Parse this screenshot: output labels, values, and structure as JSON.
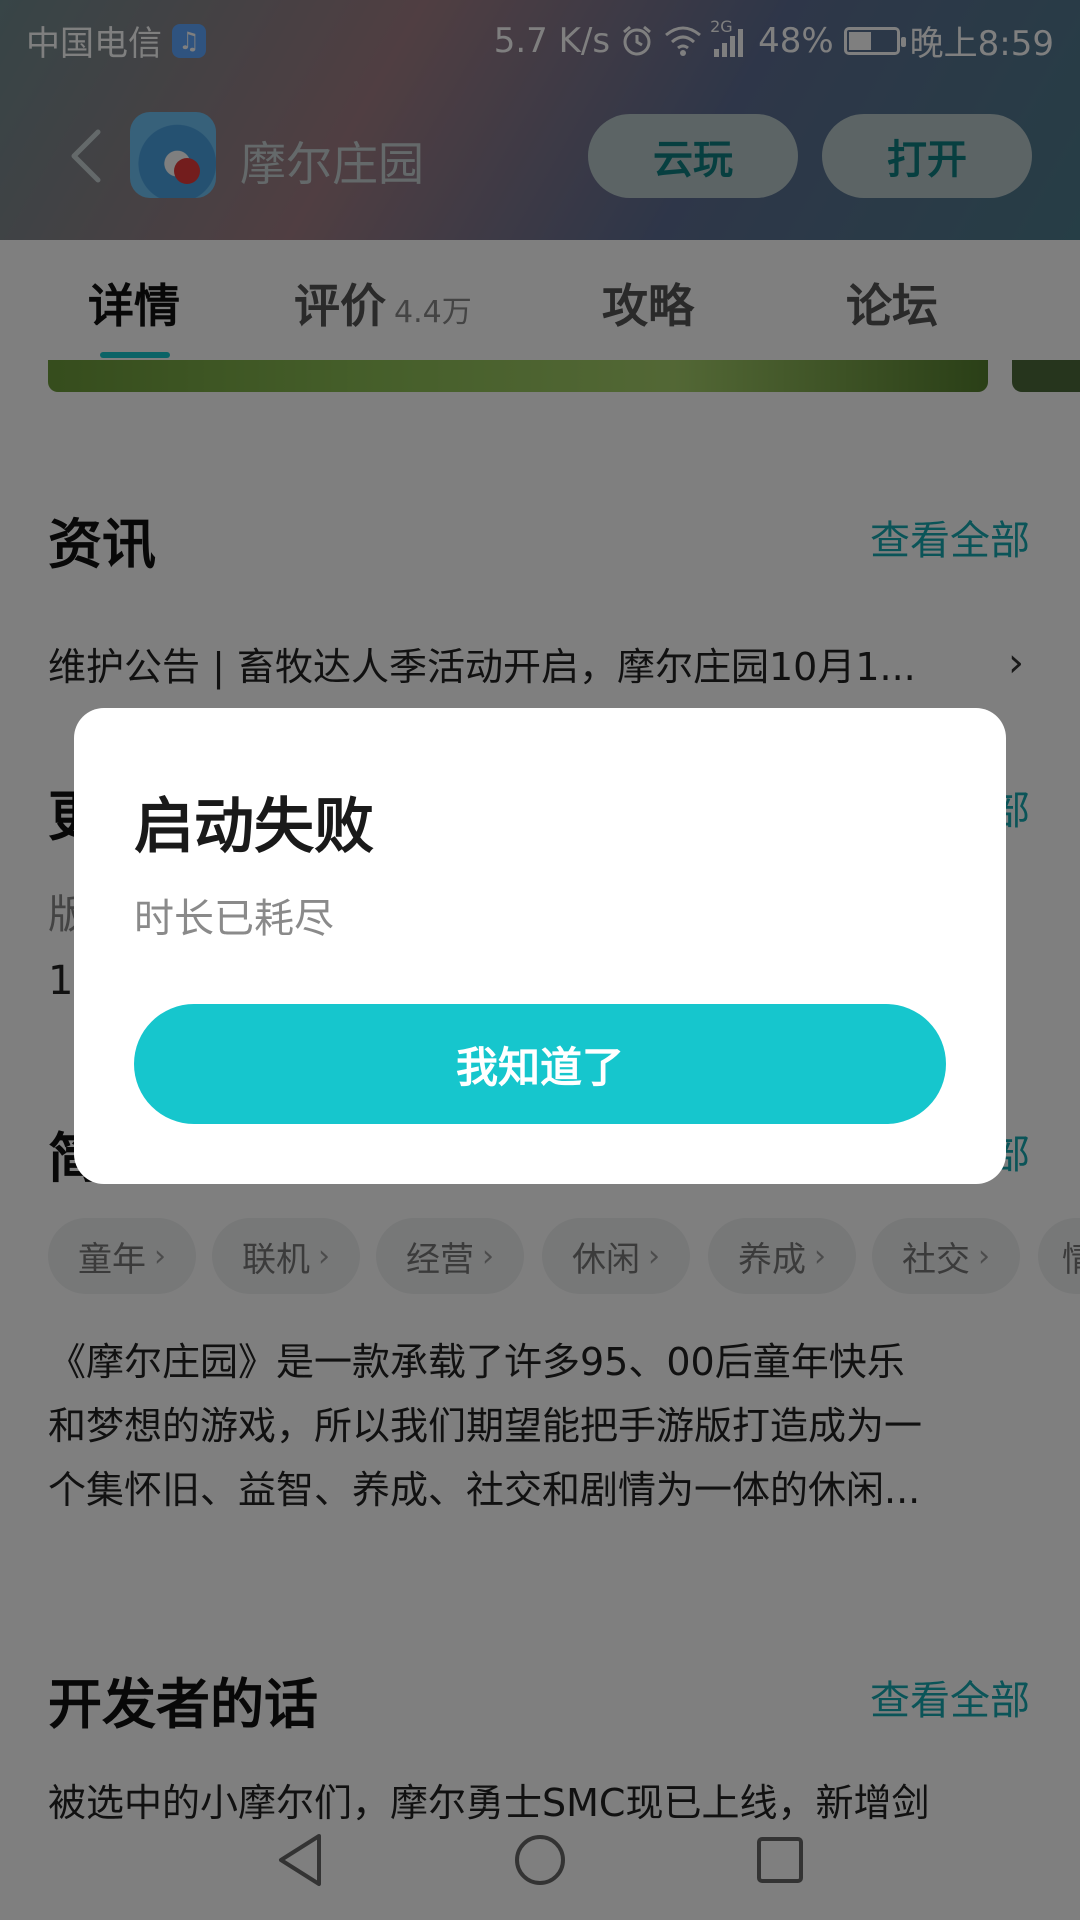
{
  "status_bar": {
    "carrier": "中国电信",
    "speed": "5.7 K/s",
    "network": "2G",
    "battery": "48%",
    "battery_level": 0.48,
    "time": "晚上8:59",
    "icons": [
      "music-app-icon",
      "alarm-icon",
      "wifi-icon",
      "signal-icon",
      "battery-icon"
    ]
  },
  "header": {
    "back_icon": "chevron-left-icon",
    "app_name": "摩尔庄园",
    "cloud_play_label": "云玩",
    "open_label": "打开"
  },
  "tabs": [
    {
      "label": "详情",
      "active": true
    },
    {
      "label": "评价",
      "sub": "4.4万"
    },
    {
      "label": "攻略"
    },
    {
      "label": "论坛"
    }
  ],
  "news": {
    "title": "资讯",
    "view_all": "查看全部",
    "headline": "维护公告 | 畜牧达人季活动开启，摩尔庄园10月1..."
  },
  "partial_text": {
    "update_initial": "更",
    "version_initial": "版",
    "number_initial": "1",
    "intro_initial": "简",
    "view_all_partial_1": "部",
    "view_all_partial_2": "部"
  },
  "tags": [
    "童年",
    "联机",
    "经营",
    "休闲",
    "养成",
    "社交",
    "情"
  ],
  "description": {
    "line1": "《摩尔庄园》是一款承载了许多95、00后童年快乐",
    "line2": "和梦想的游戏，所以我们期望能把手游版打造成为一",
    "line3": "个集怀旧、益智、养成、社交和剧情为一体的休闲..."
  },
  "developer": {
    "title": "开发者的话",
    "view_all": "查看全部",
    "text": "被选中的小摩尔们，摩尔勇士SMC现已上线，新增剑"
  },
  "dialog": {
    "title": "启动失败",
    "message": "时长已耗尽",
    "button": "我知道了"
  },
  "colors": {
    "accent": "#16c6cd",
    "link": "#16a9b0",
    "overlay": "rgba(0,0,0,0.5)"
  }
}
